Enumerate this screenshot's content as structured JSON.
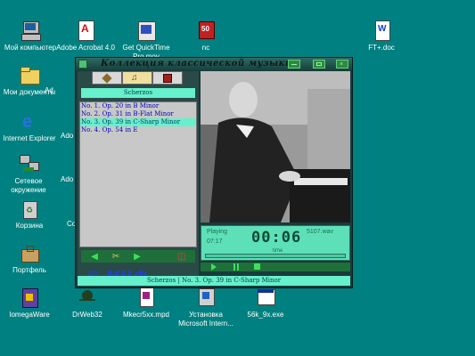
{
  "desktop": {
    "icons": [
      {
        "label": "Мой компьютер"
      },
      {
        "label": "Adobe Acrobat 4.0"
      },
      {
        "label": "Get QuickTime Pro.mov"
      },
      {
        "label": "nc"
      },
      {
        "label": "FT+.doc"
      },
      {
        "label": "Мои документы"
      },
      {
        "label": "Internet Explorer"
      },
      {
        "label": "Сетевое окружение"
      },
      {
        "label": "Корзина"
      },
      {
        "label": "Портфель"
      },
      {
        "label": "IomegaWare"
      },
      {
        "label": "DrWeb32"
      },
      {
        "label": "Mkecr5xx.mpd"
      },
      {
        "label": "Установка Microsoft Intern..."
      },
      {
        "label": "56k_9x.exe"
      }
    ],
    "partial_labels": [
      "Ad",
      "Ado",
      "Ado",
      "Ado",
      "Co"
    ]
  },
  "player": {
    "title": "Коллекция классической музыки",
    "list_header": "Scherzos",
    "tracks": [
      {
        "label": "No. 1. Op. 20 in B Minor",
        "selected": false
      },
      {
        "label": "No. 2. Op. 31 in B-Flat Minor",
        "selected": false
      },
      {
        "label": "No. 3. Op. 39 in C-Sharp Minor",
        "selected": true
      },
      {
        "label": "No. 4. Op. 54 in E",
        "selected": false
      }
    ],
    "logo": "© МЦФ",
    "status": {
      "state": "Playing",
      "elapsed": "07:17",
      "timer": "00:06",
      "time_label": "time",
      "file": "5107.wav"
    },
    "statusbar": "Scherzos  |  No. 3. Op. 39 in C-Sharp Minor"
  },
  "colors": {
    "desktop": "#008080",
    "accent": "#66f0cc",
    "list_link": "#0000c0"
  }
}
